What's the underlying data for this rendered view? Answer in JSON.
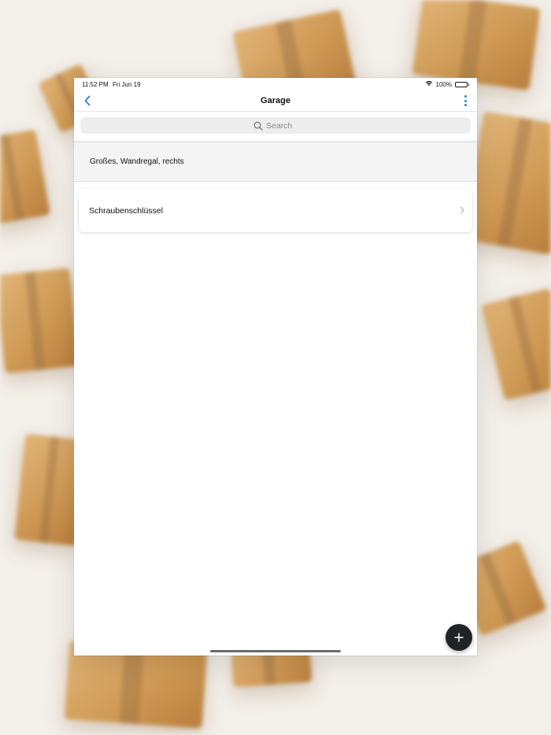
{
  "status_bar": {
    "time": "11:52 PM",
    "date": "Fri Jun 19",
    "battery": "100%",
    "wifi_icon": "wifi-icon",
    "battery_icon": "battery-icon"
  },
  "nav": {
    "title": "Garage",
    "back_icon": "chevron-left-icon",
    "menu_icon": "more-vertical-icon"
  },
  "search": {
    "placeholder": "Search",
    "value": "",
    "icon": "search-icon"
  },
  "location": {
    "label": "Großes, Wandregal, rechts"
  },
  "items": [
    {
      "label": "Schraubenschlüssel",
      "icon": "chevron-right-icon"
    }
  ],
  "fab": {
    "icon": "plus-icon"
  },
  "colors": {
    "accent": "#2f7fe0",
    "fab_background": "#1f2326",
    "header_background": "#f4f4f4",
    "search_background": "#ededed"
  }
}
